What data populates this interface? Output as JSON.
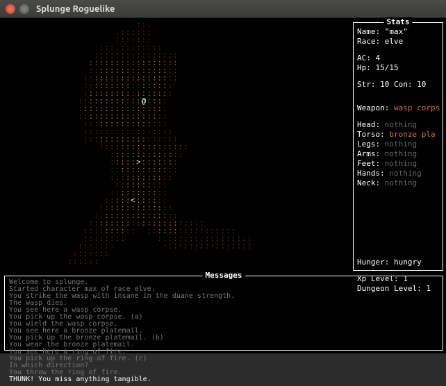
{
  "window": {
    "title": "Splunge Roguelike"
  },
  "stats_panel": {
    "label": "Stats",
    "name_label": "Name:",
    "name_value": "\"max\"",
    "race_label": "Race:",
    "race_value": "elve",
    "ac_label": "AC:",
    "ac_value": "4",
    "hp_label": "Hp:",
    "hp_value": "15/15",
    "str_label": "Str:",
    "str_value": "10",
    "con_label": "Con:",
    "con_value": "10",
    "weapon_label": "Weapon:",
    "weapon_value": "wasp corps",
    "head_label": "Head:",
    "head_value": "nothing",
    "torso_label": "Torso:",
    "torso_value": "bronze pla",
    "legs_label": "Legs:",
    "legs_value": "nothing",
    "arms_label": "Arms:",
    "arms_value": "nothing",
    "feet_label": "Feet:",
    "feet_value": "nothing",
    "hands_label": "Hands:",
    "hands_value": "nothing",
    "neck_label": "Neck:",
    "neck_value": "nothing",
    "hunger_label": "Hunger:",
    "hunger_value": "hungry",
    "xp_label": "Xp Level:",
    "xp_value": "1",
    "dungeon_label": "Dungeon Level:",
    "dungeon_value": "1"
  },
  "messages_panel": {
    "label": "Messages",
    "lines": [
      "Welcome to splunge.",
      "Started character max of race elve.",
      "You strike the wasp with insane in the duane strength.",
      "The wasp dies.",
      "You see here a wasp corpse.",
      "You pick up the wasp corpse. (a)",
      "You wield the wasp corpse.",
      "You see here a bronze platemail.",
      "You pick up the bronze platemail. (b)",
      "You wear the bronze platemail.",
      "You see here a ring of fire.",
      "You pick up the ring of fire. (c)",
      "In which direction?",
      "You throw the ring of fire."
    ],
    "current": "THUNK! You miss anything tangible."
  },
  "player_glyph": "@",
  "cursor_glyphs": {
    "right": ">",
    "left": "<"
  }
}
